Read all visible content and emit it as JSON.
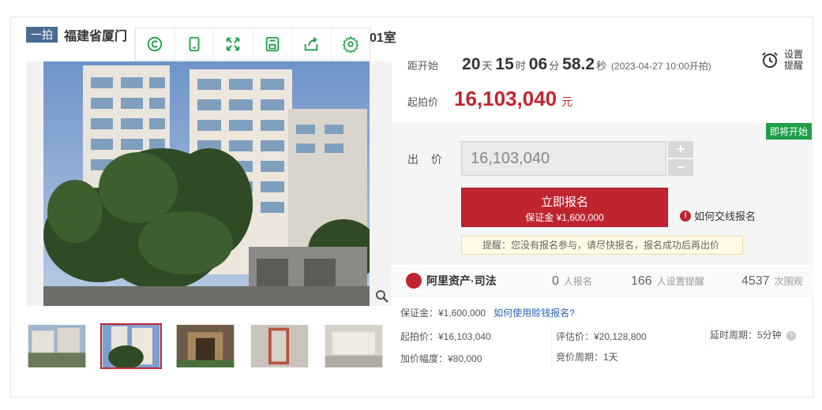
{
  "title": {
    "badge": "一拍",
    "text": "福建省厦门",
    "tail": "01室"
  },
  "toolbar": {
    "items": [
      "copyright-icon",
      "tablet-icon",
      "fullscreen-icon",
      "save-icon",
      "share-icon",
      "settings-icon"
    ]
  },
  "countdown": {
    "label": "距开始",
    "days": "20",
    "days_unit": "天",
    "hours": "15",
    "hours_unit": "时",
    "minutes": "06",
    "minutes_unit": "分",
    "seconds": "58.2",
    "seconds_unit": "秒",
    "note": "(2023-04-27 10:00开拍)"
  },
  "remind": {
    "label": "设置提醒"
  },
  "start_price": {
    "label": "起拍价",
    "value": "16,103,040",
    "unit": "元"
  },
  "bid": {
    "status_badge": "即将开始",
    "label": "出 价",
    "input_value": "16,103,040",
    "plus": "+",
    "minus": "−",
    "signup_main": "立即报名",
    "signup_sub": "保证金 ¥1,600,000",
    "how_pay": "如何交线报名",
    "tip": "提醒：您没有报名参与，请尽快报名，报名成功后再出价"
  },
  "stats": {
    "brand": "阿里资产·司法",
    "signups": "0",
    "signups_label": "人报名",
    "reminders": "166",
    "reminders_label": "人设置提醒",
    "views": "4537",
    "views_label": "次围观"
  },
  "details": {
    "deposit": "保证金：¥1,600,000",
    "deposit_link": "如何使用赊钱报名?",
    "start_price": "起拍价：¥16,103,040",
    "appraisal": "评估价：¥20,128,800",
    "delay": "延时周期：5分钟",
    "increment": "加价幅度：¥80,000",
    "cycle": "竞价周期：1天"
  },
  "colors": {
    "accent": "#c0252f",
    "badge": "#4a6c93",
    "soon": "#1e9e48",
    "link": "#2a63b8"
  }
}
